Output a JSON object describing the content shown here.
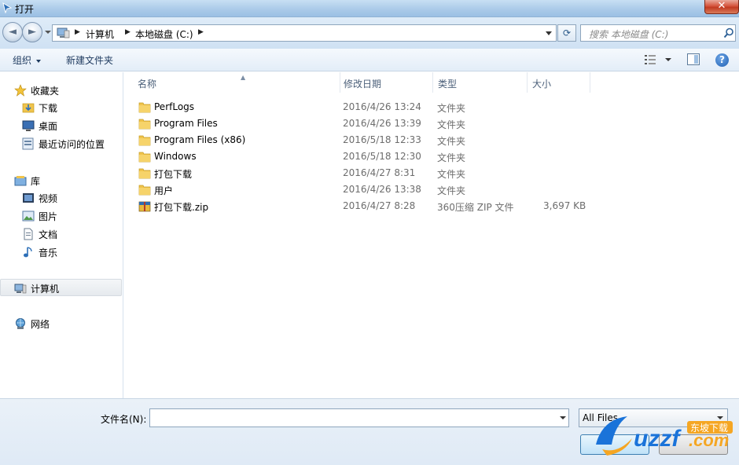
{
  "window": {
    "title": "打开",
    "close_glyph": "✕"
  },
  "nav": {
    "back_glyph": "◄",
    "forward_glyph": "►",
    "breadcrumb": [
      "计算机",
      "本地磁盘 (C:)"
    ],
    "crumb_separator": "▶",
    "refresh_glyph": "⟳",
    "search_placeholder": "搜索 本地磁盘 (C:)"
  },
  "toolbar": {
    "organize": "组织",
    "new_folder": "新建文件夹",
    "help": "?"
  },
  "sidebar": {
    "favorites": {
      "label": "收藏夹",
      "icon": "star-icon",
      "items": [
        {
          "label": "下载",
          "icon": "downloads-folder-icon"
        },
        {
          "label": "桌面",
          "icon": "desktop-icon"
        },
        {
          "label": "最近访问的位置",
          "icon": "recent-places-icon"
        }
      ]
    },
    "libraries": {
      "label": "库",
      "icon": "library-icon",
      "items": [
        {
          "label": "视频",
          "icon": "video-library-icon"
        },
        {
          "label": "图片",
          "icon": "picture-library-icon"
        },
        {
          "label": "文档",
          "icon": "document-library-icon"
        },
        {
          "label": "音乐",
          "icon": "music-library-icon"
        }
      ]
    },
    "computer": {
      "label": "计算机",
      "icon": "computer-icon",
      "selected": true
    },
    "network": {
      "label": "网络",
      "icon": "network-icon"
    }
  },
  "columns": [
    "名称",
    "修改日期",
    "类型",
    "大小"
  ],
  "files": [
    {
      "name": "PerfLogs",
      "date": "2016/4/26 13:24",
      "type": "文件夹",
      "size": "",
      "icon": "folder-icon"
    },
    {
      "name": "Program Files",
      "date": "2016/4/26 13:39",
      "type": "文件夹",
      "size": "",
      "icon": "folder-icon"
    },
    {
      "name": "Program Files (x86)",
      "date": "2016/5/18 12:33",
      "type": "文件夹",
      "size": "",
      "icon": "folder-icon"
    },
    {
      "name": "Windows",
      "date": "2016/5/18 12:30",
      "type": "文件夹",
      "size": "",
      "icon": "folder-icon"
    },
    {
      "name": "打包下载",
      "date": "2016/4/27 8:31",
      "type": "文件夹",
      "size": "",
      "icon": "folder-icon"
    },
    {
      "name": "用户",
      "date": "2016/4/26 13:38",
      "type": "文件夹",
      "size": "",
      "icon": "folder-icon"
    },
    {
      "name": "打包下载.zip",
      "date": "2016/4/27 8:28",
      "type": "360压缩 ZIP 文件",
      "size": "3,697 KB",
      "icon": "zip-archive-icon"
    }
  ],
  "bottom": {
    "filename_label": "文件名(N):",
    "filename_value": "",
    "filter_value": "All Files"
  },
  "watermark": {
    "brand": "uzzf.com",
    "tag": "东坡下载"
  },
  "colors": {
    "accent": "#1f5fb3",
    "folder": "#f0c44c",
    "close": "#c23b22",
    "watermark_orange": "#f5a623",
    "watermark_blue": "#1a73d9"
  }
}
